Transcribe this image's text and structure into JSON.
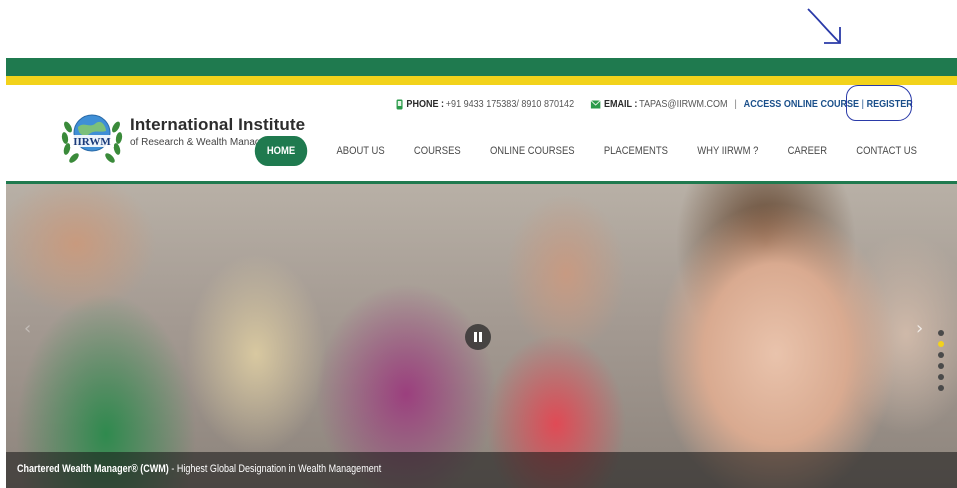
{
  "header": {
    "brand": {
      "logo_text": "IIRWM",
      "title": "International Institute",
      "subtitle": "of Research & Wealth Management"
    },
    "contact": {
      "phone_label": "PHONE :",
      "phone_value": "+91 9433 175383/ 8910 870142",
      "email_label": "EMAIL :",
      "email_value": "TAPAS@IIRWM.COM",
      "separator": "|",
      "access_label": "ACCESS ONLINE COURSE",
      "register_label": "REGISTER"
    },
    "nav": [
      {
        "label": "HOME",
        "active": true
      },
      {
        "label": "ABOUT US"
      },
      {
        "label": "COURSES"
      },
      {
        "label": "ONLINE COURSES"
      },
      {
        "label": "PLACEMENTS"
      },
      {
        "label": "WHY IIRWM ?"
      },
      {
        "label": "CAREER"
      },
      {
        "label": "CONTACT US"
      }
    ]
  },
  "hero": {
    "caption_title": "Chartered Wealth Manager® (CWM)",
    "caption_rest": " - Highest Global Designation in Wealth Management",
    "next_glyph": "›",
    "prev_glyph": "‹",
    "slide_count": 6,
    "active_slide": 2
  },
  "colors": {
    "brand_green": "#1f7a4f",
    "brand_yellow": "#f2d21b",
    "link_blue": "#1a4f8a",
    "annotation_blue": "#2a3aa8"
  },
  "icons": {
    "phone": "phone-icon",
    "email": "envelope-icon",
    "pause": "pause-icon",
    "next": "chevron-right-icon"
  }
}
